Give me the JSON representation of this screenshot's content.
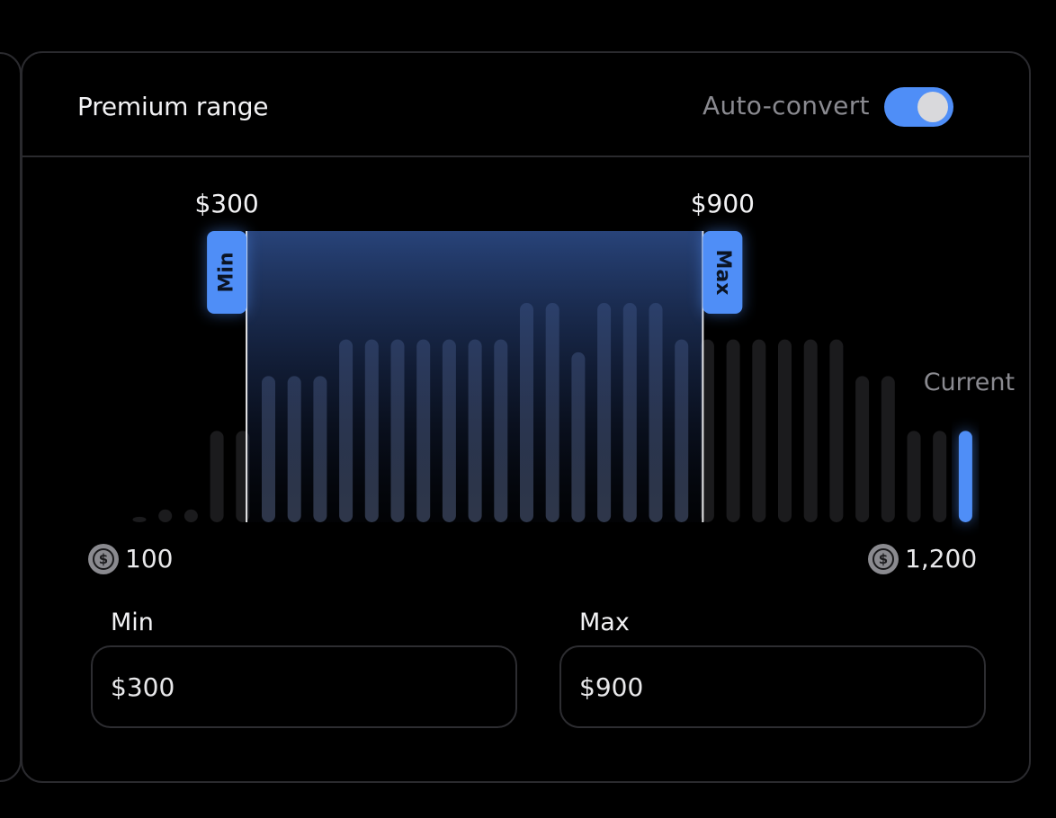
{
  "header": {
    "title": "Premium range",
    "auto_convert_label": "Auto-convert",
    "auto_convert_on": true
  },
  "colors": {
    "accent": "#4f8ef7",
    "bar": "#1b1b1d",
    "bar_selected": "#323a4d",
    "border": "#2a2a2e"
  },
  "range": {
    "min_value_label": "$300",
    "max_value_label": "$900",
    "min_handle_label": "Min",
    "max_handle_label": "Max",
    "current_label": "Current",
    "start_label": "100",
    "end_label": "1,200",
    "icon": "dollar-coin-icon"
  },
  "inputs": {
    "min_label": "Min",
    "min_value": "$300",
    "max_label": "Max",
    "max_value": "$900"
  },
  "chart_data": {
    "type": "bar",
    "title": "",
    "domain": [
      100,
      1200
    ],
    "selected_range": [
      300,
      900
    ],
    "bin_width": 33,
    "bin_start": 111,
    "values": [
      0.03,
      0.07,
      0.07,
      0.5,
      0.5,
      0.8,
      0.8,
      0.8,
      1.0,
      1.0,
      1.0,
      1.0,
      1.0,
      1.0,
      1.0,
      1.2,
      1.2,
      0.93,
      1.2,
      1.2,
      1.2,
      1.0,
      1.0,
      1.0,
      1.0,
      1.0,
      1.0,
      1.0,
      0.8,
      0.8,
      0.5,
      0.5,
      0.5
    ],
    "current_index": 32,
    "ylim": [
      0,
      1.3
    ]
  }
}
